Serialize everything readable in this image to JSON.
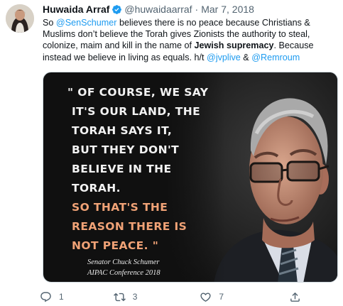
{
  "author": {
    "display_name": "Huwaida Arraf",
    "handle": "@huwaidaarraf",
    "separator": "·",
    "date": "Mar 7, 2018",
    "verified": true
  },
  "tweet": {
    "t1": "So ",
    "m1": "@SenSchumer",
    "t2": " believes there is no peace because Christians & Muslims don’t believe the Torah gives Zionists the authority to steal, colonize, maim and kill in the name of ",
    "b1": "Jewish supremacy",
    "t3": ". Because instead we believe in living as equals.  h/t ",
    "m2": "@jvplive",
    "t4": " & ",
    "m3": "@Remroum"
  },
  "media": {
    "quote_lines": [
      "\" OF COURSE, WE SAY",
      "IT'S OUR LAND, THE",
      "TORAH SAYS IT,",
      "BUT THEY DON'T",
      "BELIEVE IN THE",
      "TORAH."
    ],
    "accent_lines": [
      "SO THAT'S THE",
      "REASON THERE IS",
      "NOT PEACE. \""
    ],
    "attribution_name": "Senator Chuck Schumer",
    "attribution_event": "AIPAC Conference 2018",
    "colors": {
      "quote_text": "#f2f2f2",
      "accent_text": "#f0a276",
      "background": "#101010"
    }
  },
  "actions": {
    "reply_count": "1",
    "retweet_count": "3",
    "like_count": "7",
    "share_count": ""
  },
  "icons": [
    "verified-badge-icon",
    "reply-icon",
    "retweet-icon",
    "like-icon",
    "share-icon"
  ],
  "colors": {
    "link": "#1d9bf0",
    "muted": "#536471",
    "text": "#0f1419"
  }
}
